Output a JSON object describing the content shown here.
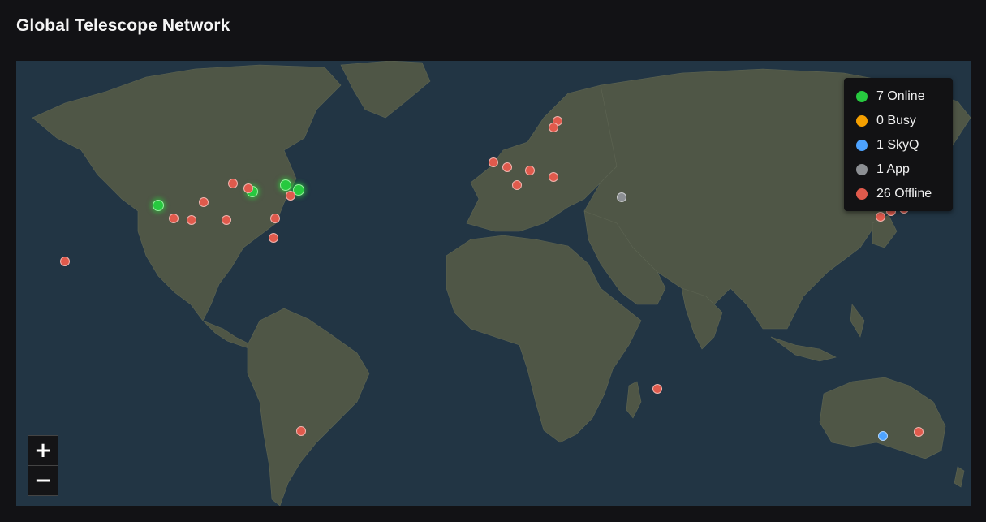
{
  "header": {
    "title": "Global Telescope Network"
  },
  "legend": [
    {
      "label": "7 Online",
      "color": "#27c93f"
    },
    {
      "label": "0 Busy",
      "color": "#f5a000"
    },
    {
      "label": "1 SkyQ",
      "color": "#4da3ff"
    },
    {
      "label": "1 App",
      "color": "#8c8f93"
    },
    {
      "label": "26 Offline",
      "color": "#e05a4c"
    }
  ],
  "zoom": {
    "in_label": "+",
    "out_label": "−"
  },
  "markers": [
    {
      "status": "online",
      "lon": -122.0,
      "lat": 37.5
    },
    {
      "status": "online",
      "lon": -88.0,
      "lat": 41.9
    },
    {
      "status": "online",
      "lon": -76.3,
      "lat": 43.8
    },
    {
      "status": "online",
      "lon": -71.5,
      "lat": 42.4
    },
    {
      "status": "offline",
      "lon": -155.5,
      "lat": 19.8
    },
    {
      "status": "offline",
      "lon": -116.5,
      "lat": 33.5
    },
    {
      "status": "offline",
      "lon": -110.0,
      "lat": 32.8
    },
    {
      "status": "offline",
      "lon": -105.5,
      "lat": 38.5
    },
    {
      "status": "offline",
      "lon": -97.5,
      "lat": 33.0
    },
    {
      "status": "offline",
      "lon": -95.0,
      "lat": 44.5
    },
    {
      "status": "offline",
      "lon": -89.5,
      "lat": 43.0
    },
    {
      "status": "offline",
      "lon": -80.5,
      "lat": 27.3
    },
    {
      "status": "offline",
      "lon": -80.0,
      "lat": 33.5
    },
    {
      "status": "offline",
      "lon": -74.5,
      "lat": 40.5
    },
    {
      "status": "offline",
      "lon": -70.5,
      "lat": -33.5
    },
    {
      "status": "offline",
      "lon": -1.5,
      "lat": 51.0
    },
    {
      "status": "offline",
      "lon": 3.5,
      "lat": 49.5
    },
    {
      "status": "offline",
      "lon": 7.0,
      "lat": 44.0
    },
    {
      "status": "offline",
      "lon": 11.5,
      "lat": 48.5
    },
    {
      "status": "offline",
      "lon": 20.0,
      "lat": 46.5
    },
    {
      "status": "offline",
      "lon": 21.5,
      "lat": 64.0
    },
    {
      "status": "offline",
      "lon": 20.0,
      "lat": 62.0
    },
    {
      "status": "offline",
      "lon": 57.5,
      "lat": -20.3
    },
    {
      "status": "offline",
      "lon": 137.5,
      "lat": 34.0
    },
    {
      "status": "offline",
      "lon": 141.5,
      "lat": 35.8
    },
    {
      "status": "offline",
      "lon": 146.0,
      "lat": 36.5
    },
    {
      "status": "offline",
      "lon": 151.2,
      "lat": -33.8
    },
    {
      "status": "skyq",
      "lon": 138.5,
      "lat": -35.0
    },
    {
      "status": "app",
      "lon": 44.5,
      "lat": 40.2
    }
  ]
}
